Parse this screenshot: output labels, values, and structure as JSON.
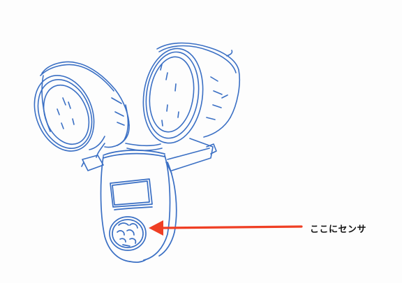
{
  "annotation": {
    "label": "ここにセンサ"
  },
  "colors": {
    "sketch_line": "#3a6fc4",
    "arrow": "#ef3f24",
    "label_text": "#111111",
    "background": "#fdfdfd"
  }
}
